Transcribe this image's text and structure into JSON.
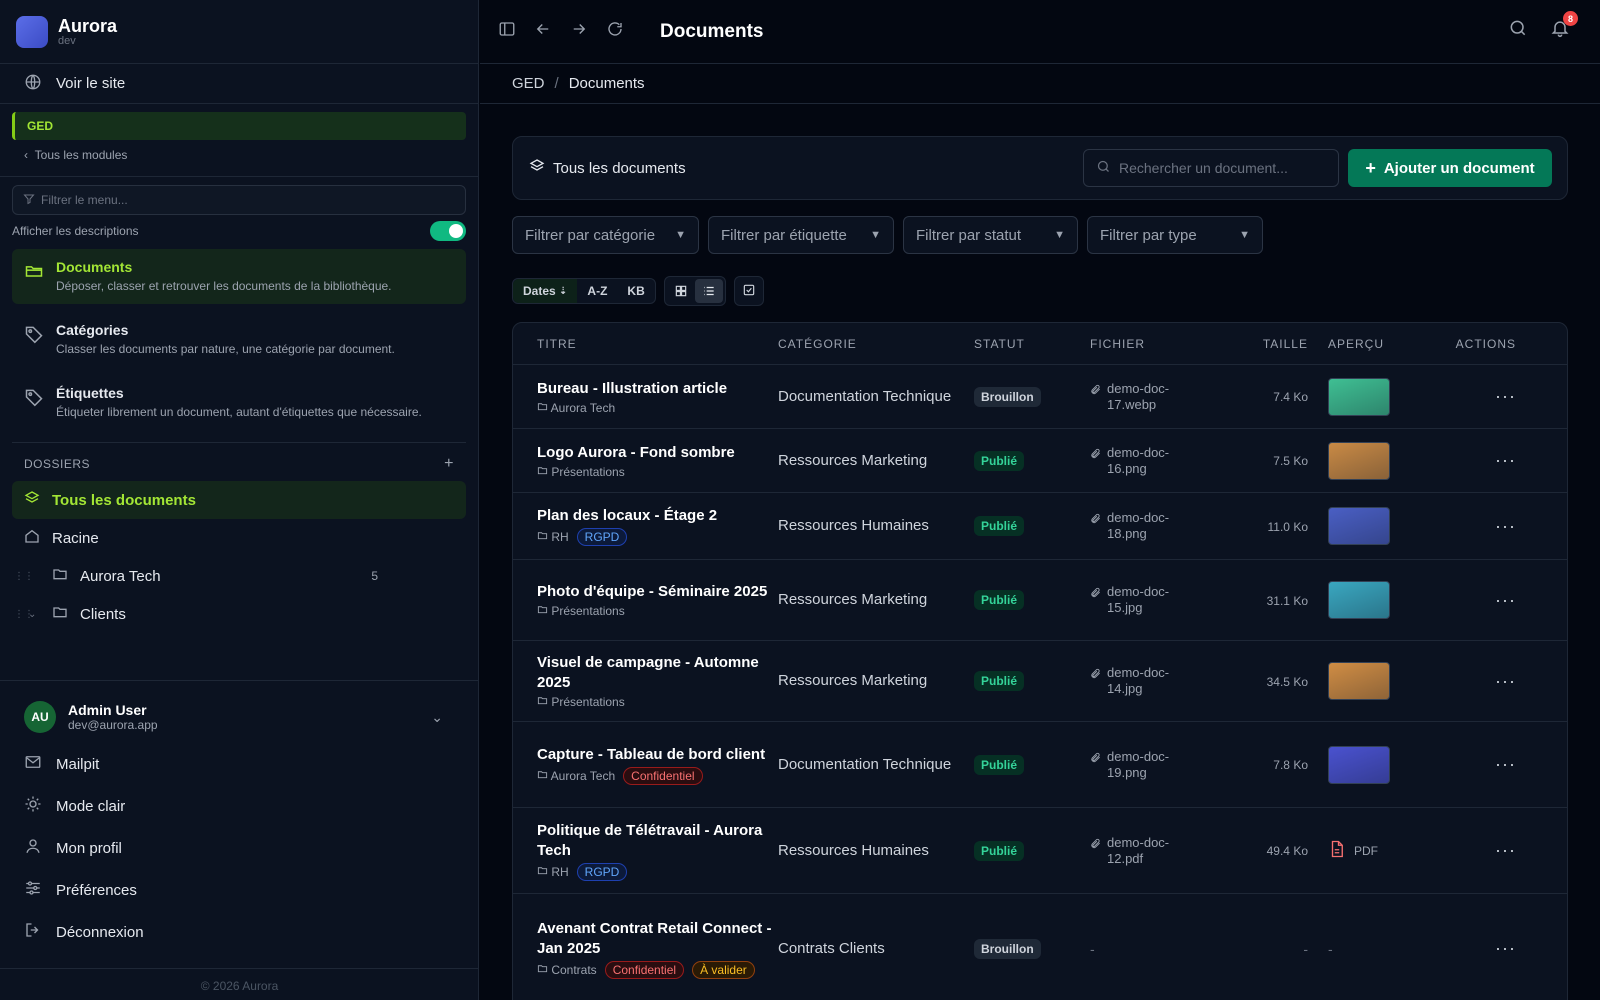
{
  "brand": {
    "name": "Aurora",
    "env": "dev"
  },
  "sidebar": {
    "visit_site": "Voir le site",
    "module_tag": "GED",
    "all_modules": "Tous les modules",
    "filter_placeholder": "Filtrer le menu...",
    "show_descriptions": "Afficher les descriptions",
    "nav": [
      {
        "title": "Documents",
        "desc": "Déposer, classer et retrouver les documents de la bibliothèque."
      },
      {
        "title": "Catégories",
        "desc": "Classer les documents par nature, une catégorie par document."
      },
      {
        "title": "Étiquettes",
        "desc": "Étiqueter librement un document, autant d'étiquettes que nécessaire."
      }
    ],
    "folders_heading": "DOSSIERS",
    "folders": [
      {
        "label": "Tous les documents"
      },
      {
        "label": "Racine"
      },
      {
        "label": "Aurora Tech",
        "count": "5"
      },
      {
        "label": "Clients"
      }
    ],
    "user": {
      "initials": "AU",
      "name": "Admin User",
      "email": "dev@aurora.app"
    },
    "links": [
      "Mailpit",
      "Mode clair",
      "Mon profil",
      "Préférences",
      "Déconnexion"
    ],
    "copyright": "© 2026 Aurora"
  },
  "topbar": {
    "title": "Documents",
    "notifications": "8"
  },
  "breadcrumb": {
    "root": "GED",
    "current": "Documents"
  },
  "toolbar": {
    "section_label": "Tous les documents",
    "search_placeholder": "Rechercher un document...",
    "add_label": "Ajouter un document"
  },
  "filters": [
    "Filtrer par catégorie",
    "Filtrer par étiquette",
    "Filtrer par statut",
    "Filtrer par type"
  ],
  "sort": {
    "dates": "Dates",
    "az": "A-Z",
    "kb": "KB"
  },
  "table": {
    "headers": [
      "TITRE",
      "CATÉGORIE",
      "STATUT",
      "FICHIER",
      "TAILLE",
      "APERÇU",
      "ACTIONS"
    ],
    "rows": [
      {
        "title": "Bureau - Illustration article",
        "folder": "Aurora Tech",
        "tags": [],
        "category": "Documentation Technique",
        "status": "Brouillon",
        "file": "demo-doc-17.webp",
        "size": "7.4 Ko",
        "preview": "#3fbf93"
      },
      {
        "title": "Logo Aurora - Fond sombre",
        "folder": "Présentations",
        "tags": [],
        "category": "Ressources Marketing",
        "status": "Publié",
        "file": "demo-doc-16.png",
        "size": "7.5 Ko",
        "preview": "#c98a45"
      },
      {
        "title": "Plan des locaux - Étage 2",
        "folder": "RH",
        "tags": [
          "RGPD"
        ],
        "category": "Ressources Humaines",
        "status": "Publié",
        "file": "demo-doc-18.png",
        "size": "11.0 Ko",
        "preview": "#4a5fc4"
      },
      {
        "title": "Photo d'équipe - Séminaire 2025",
        "folder": "Présentations",
        "tags": [],
        "category": "Ressources Marketing",
        "status": "Publié",
        "file": "demo-doc-15.jpg",
        "size": "31.1 Ko",
        "preview": "#3aa7c0"
      },
      {
        "title": "Visuel de campagne - Automne 2025",
        "folder": "Présentations",
        "tags": [],
        "category": "Ressources Marketing",
        "status": "Publié",
        "file": "demo-doc-14.jpg",
        "size": "34.5 Ko",
        "preview": "#d08d44"
      },
      {
        "title": "Capture - Tableau de bord client",
        "folder": "Aurora Tech",
        "tags": [
          "Confidentiel"
        ],
        "category": "Documentation Technique",
        "status": "Publié",
        "file": "demo-doc-19.png",
        "size": "7.8 Ko",
        "preview": "#4a52cf"
      },
      {
        "title": "Politique de Télétravail - Aurora Tech",
        "folder": "RH",
        "tags": [
          "RGPD"
        ],
        "category": "Ressources Humaines",
        "status": "Publié",
        "file": "demo-doc-12.pdf",
        "size": "49.4 Ko",
        "preview": "PDF"
      },
      {
        "title": "Avenant Contrat Retail Connect - Jan 2025",
        "folder": "Contrats",
        "tags": [
          "Confidentiel",
          "À valider"
        ],
        "category": "Contrats Clients",
        "status": "Brouillon",
        "file": "-",
        "size": "-",
        "preview": "-"
      }
    ]
  }
}
